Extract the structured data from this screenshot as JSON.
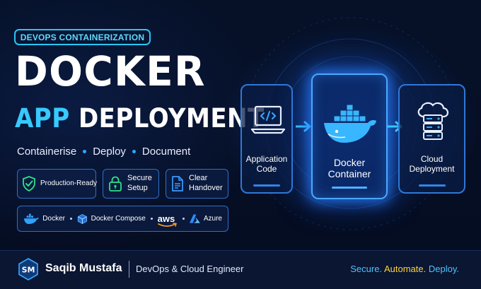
{
  "badge": "DEVOPS CONTAINERIZATION",
  "title_line1": "DOCKER",
  "title_line2a": "APP",
  "title_line2b": "DEPLOYMENT",
  "tagline": [
    "Containerise",
    "Deploy",
    "Document"
  ],
  "features": [
    {
      "label": "Production-Ready",
      "icon": "shield-check-icon"
    },
    {
      "label_line1": "Secure",
      "label_line2": "Setup",
      "icon": "padlock-icon"
    },
    {
      "label_line1": "Clear",
      "label_line2": "Handover",
      "icon": "document-icon"
    }
  ],
  "tech": [
    {
      "label": "Docker",
      "icon": "docker-whale-icon"
    },
    {
      "label": "Docker Compose",
      "icon": "cube-icon"
    },
    {
      "label": "aws",
      "icon": "aws-logo"
    },
    {
      "label": "Azure",
      "icon": "azure-logo"
    }
  ],
  "flow": [
    {
      "line1": "Application",
      "line2": "Code",
      "icon": "laptop-code-icon"
    },
    {
      "line1": "Docker",
      "line2": "Container",
      "icon": "docker-whale-icon"
    },
    {
      "line1": "Cloud",
      "line2": "Deployment",
      "icon": "cloud-server-icon"
    }
  ],
  "footer": {
    "logo": "SM",
    "name": "Saqib Mustafa",
    "role": "DevOps & Cloud Engineer",
    "motto": [
      "Secure.",
      "Automate.",
      "Deploy."
    ]
  },
  "colors": {
    "background": "#050c1f",
    "accent_cyan": "#37c9ff",
    "accent_blue": "#2f86e8",
    "glow": "#4aa8ff",
    "highlight_yellow": "#ffd23a",
    "check_green": "#2ee08a"
  }
}
